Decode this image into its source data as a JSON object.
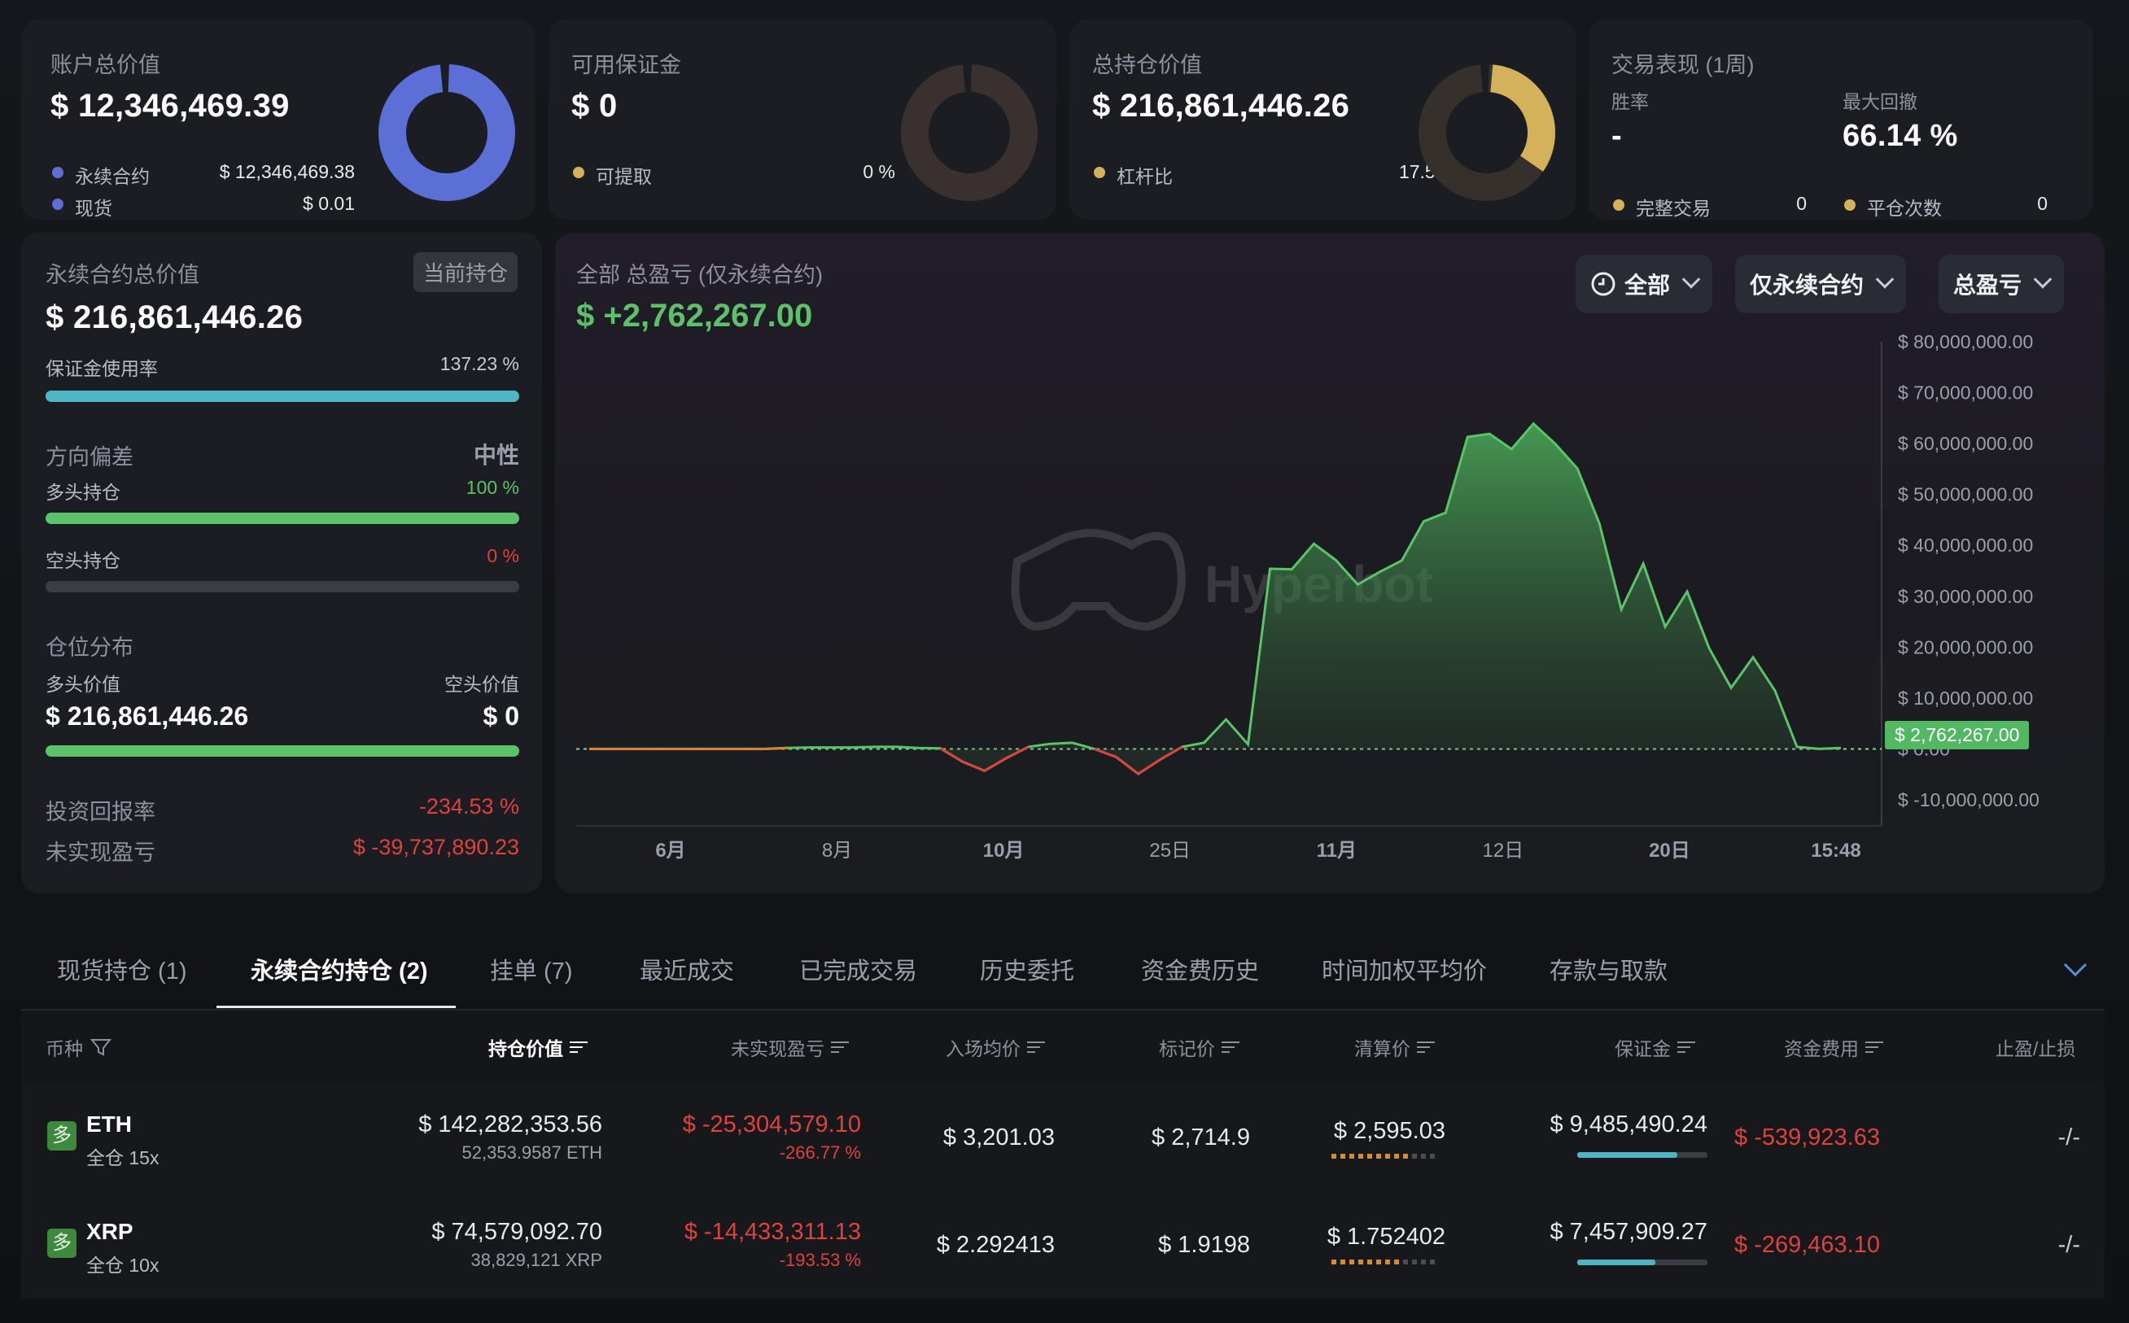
{
  "summary": {
    "account_total": {
      "label": "账户总价值",
      "value": "$ 12,346,469.39",
      "rows": [
        {
          "label": "永续合约",
          "value": "$ 12,346,469.38"
        },
        {
          "label": "现货",
          "value": "$ 0.01"
        }
      ]
    },
    "available_margin": {
      "label": "可用保证金",
      "value": "$ 0",
      "rows": [
        {
          "label": "可提取",
          "value": "0 %"
        }
      ]
    },
    "total_position": {
      "label": "总持仓价值",
      "value": "$ 216,861,446.26",
      "rows": [
        {
          "label": "杠杆比",
          "value": "17.56x"
        }
      ]
    },
    "trading_perf": {
      "label": "交易表现 (1周)",
      "win_rate_label": "胜率",
      "win_rate_value": "-",
      "drawdown_label": "最大回撤",
      "drawdown_value": "66.14 %",
      "completed_label": "完整交易",
      "completed_value": "0",
      "close_label": "平仓次数",
      "close_value": "0"
    }
  },
  "perp_panel": {
    "title": "永续合约总价值",
    "badge": "当前持仓",
    "value": "$ 216,861,446.26",
    "margin_usage_label": "保证金使用率",
    "margin_usage_value": "137.23 %",
    "margin_usage_fraction": 1.0,
    "bias_label": "方向偏差",
    "bias_value": "中性",
    "long_label": "多头持仓",
    "long_value": "100 %",
    "long_fraction": 1.0,
    "short_label": "空头持仓",
    "short_value": "0 %",
    "short_fraction": 0.0,
    "dist_label": "仓位分布",
    "long_val_label": "多头价值",
    "short_val_label": "空头价值",
    "long_val": "$ 216,861,446.26",
    "short_val": "$ 0",
    "dist_fraction": 1.0,
    "roi_label": "投资回报率",
    "roi_value": "-234.53 %",
    "unrealized_label": "未实现盈亏",
    "unrealized_value": "$ -39,737,890.23"
  },
  "pnl": {
    "title": "全部 总盈亏 (仅永续合约)",
    "value": "$ +2,762,267.00",
    "filters": [
      "全部",
      "仅永续合约",
      "总盈亏"
    ],
    "current_tag": "$ 2,762,267.00",
    "watermark": "Hyperbot"
  },
  "chart_data": {
    "type": "area",
    "title": "全部 总盈亏 (仅永续合约)",
    "x_tick_labels": [
      "6月",
      "8月",
      "10月",
      "25日",
      "11月",
      "12日",
      "20日",
      "15:48"
    ],
    "y_tick_labels": [
      "$ 80,000,000.00",
      "$ 70,000,000.00",
      "$ 60,000,000.00",
      "$ 50,000,000.00",
      "$ 40,000,000.00",
      "$ 30,000,000.00",
      "$ 20,000,000.00",
      "$ 10,000,000.00",
      "$ 0.00",
      "$ -10,000,000.00"
    ],
    "ylim": [
      -10000000,
      80000000
    ],
    "series": [
      {
        "values": [
          0,
          0,
          0,
          0,
          0,
          0,
          0,
          0,
          0,
          200000,
          300000,
          300000,
          300000,
          400000,
          400000,
          200000,
          100000,
          -2500000,
          -4300000,
          -1800000,
          400000,
          1000000,
          1200000,
          0,
          -1600000,
          -4900000,
          -2100000,
          400000,
          1200000,
          5800000,
          900000,
          35400000,
          35300000,
          40300000,
          37100000,
          32300000,
          34800000,
          37000000,
          44700000,
          46400000,
          61300000,
          61900000,
          58900000,
          63900000,
          59900000,
          55100000,
          44300000,
          27400000,
          36400000,
          24000000,
          30900000,
          19800000,
          12000000,
          18000000,
          11400000,
          400000,
          0,
          200000
        ]
      }
    ],
    "last_value": 2762267.0
  },
  "tabs": [
    "现货持仓 (1)",
    "永续合约持仓 (2)",
    "挂单 (7)",
    "最近成交",
    "已完成交易",
    "历史委托",
    "资金费历史",
    "时间加权平均价",
    "存款与取款"
  ],
  "table": {
    "headers": [
      "币种",
      "持仓价值",
      "未实现盈亏",
      "入场均价",
      "标记价",
      "清算价",
      "保证金",
      "资金费用",
      "止盈/止损"
    ],
    "rows": [
      {
        "side": "多",
        "symbol": "ETH",
        "mode": "全仓 15x",
        "value": "$ 142,282,353.56",
        "qty": "52,353.9587 ETH",
        "upnl": "$ -25,304,579.10",
        "upnl_pct": "-266.77 %",
        "entry": "$ 3,201.03",
        "mark": "$ 2,714.9",
        "liq": "$ 2,595.03",
        "liq_dots": 9,
        "margin": "$ 9,485,490.24",
        "margin_fraction": 0.77,
        "funding": "$ -539,923.63",
        "tpsl": "-/-"
      },
      {
        "side": "多",
        "symbol": "XRP",
        "mode": "全仓 10x",
        "value": "$ 74,579,092.70",
        "qty": "38,829,121 XRP",
        "upnl": "$ -14,433,311.13",
        "upnl_pct": "-193.53 %",
        "entry": "$ 2.292413",
        "mark": "$ 1.9198",
        "liq": "$ 1.752402",
        "liq_dots": 8,
        "margin": "$ 7,457,909.27",
        "margin_fraction": 0.6,
        "funding": "$ -269,463.10",
        "tpsl": "-/-"
      }
    ]
  },
  "colors": {
    "accent": "#5b6fd6",
    "gold": "#d3b25a",
    "green": "#5bc26a",
    "red": "#e0413d",
    "teal": "#4fb6c6"
  }
}
